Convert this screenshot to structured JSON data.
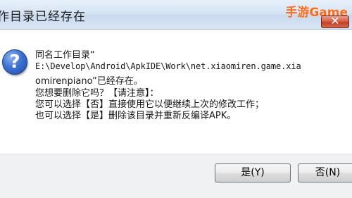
{
  "window": {
    "title": "作目录已经存在",
    "watermark": "手游Game",
    "close_label": "✕"
  },
  "dialog": {
    "icon": "question-icon",
    "line1": "同名工作目录“",
    "line2": "E:\\Develop\\Android\\ApkIDE\\Work\\net.xiaomiren.game.xia",
    "line3": "omirenpiano”已经存在。",
    "line4": "您想要删除它吗？【请注意】：",
    "line5": "您可以选择【否】直接使用它以便继续上次的修改工作；",
    "line6": "也可以选择【是】删除该目录并重新反编译APK。"
  },
  "buttons": {
    "yes_label": "是(Y)",
    "no_label": "否(N)"
  }
}
